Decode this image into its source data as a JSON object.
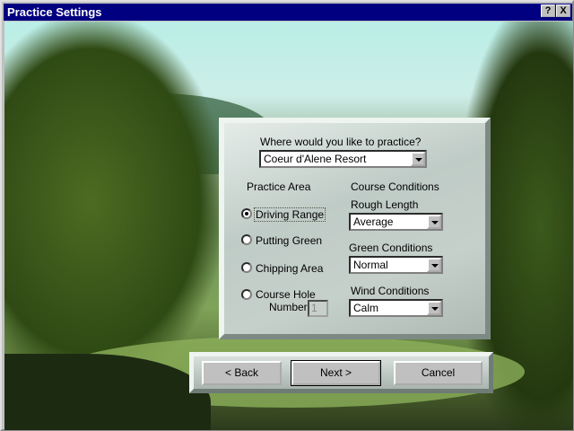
{
  "window": {
    "title": "Practice Settings",
    "help_label": "?",
    "close_label": "X"
  },
  "location": {
    "prompt": "Where would you like to practice?",
    "value": "Coeur d'Alene Resort"
  },
  "practice_area": {
    "heading": "Practice Area",
    "options": [
      {
        "label": "Driving Range",
        "selected": true
      },
      {
        "label": "Putting Green",
        "selected": false
      },
      {
        "label": "Chipping Area",
        "selected": false
      },
      {
        "label": "Course Hole",
        "selected": false
      }
    ],
    "number_label": "Number",
    "number_value": "1"
  },
  "course_conditions": {
    "heading": "Course Conditions",
    "rough_label": "Rough Length",
    "rough_value": "Average",
    "green_label": "Green Conditions",
    "green_value": "Normal",
    "wind_label": "Wind Conditions",
    "wind_value": "Calm"
  },
  "buttons": {
    "back": "< Back",
    "next": "Next >",
    "cancel": "Cancel"
  }
}
